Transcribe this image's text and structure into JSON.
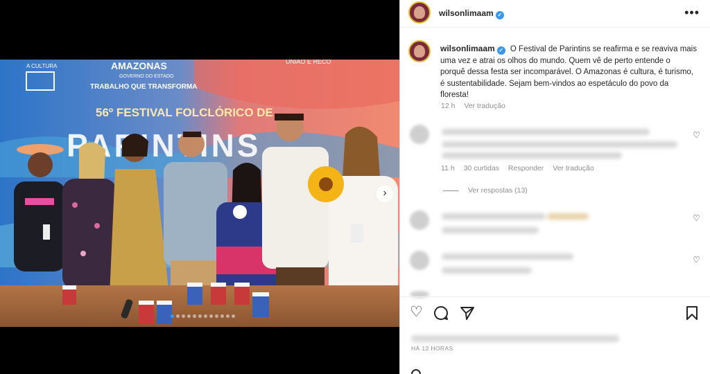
{
  "post": {
    "username": "wilsonlimaam",
    "caption": "O Festival de Parintins se reafirma e se reaviva mais uma vez e atrai os olhos do mundo. Quem vê de perto entende o porquê dessa festa ser incomparável. O Amazonas é cultura, é turismo, é sustentabilidade. Sejam bem-vindos ao espetáculo do povo da floresta!",
    "caption_age": "12 h",
    "see_translation": "Ver tradução",
    "posted_label": "HÁ 12 HORAS"
  },
  "photo": {
    "banner_brand": "AMAZONAS",
    "banner_sub": "GOVERNO DO ESTADO",
    "banner_slogan": "TRABALHO QUE TRANSFORMA",
    "banner_culture": "A CULTURA",
    "banner_union": "UNIÃO E RECO",
    "banner_title": "56º FESTIVAL FOLCLÓRICO DE",
    "banner_big": "PARINTINS",
    "carousel_count": 12,
    "carousel_active": 0
  },
  "comments": [
    {
      "age": "11 h",
      "likes": "30 curtidas",
      "reply": "Responder",
      "translate": "Ver tradução",
      "view_replies": "Ver respostas (13)"
    }
  ],
  "icons": [
    "more-options-icon",
    "heart-icon",
    "comment-icon",
    "share-icon",
    "bookmark-icon",
    "verified-badge-icon",
    "carousel-next-icon"
  ],
  "colors": {
    "verified": "#3897f0",
    "text": "#262626",
    "muted": "#8e8e8e"
  }
}
